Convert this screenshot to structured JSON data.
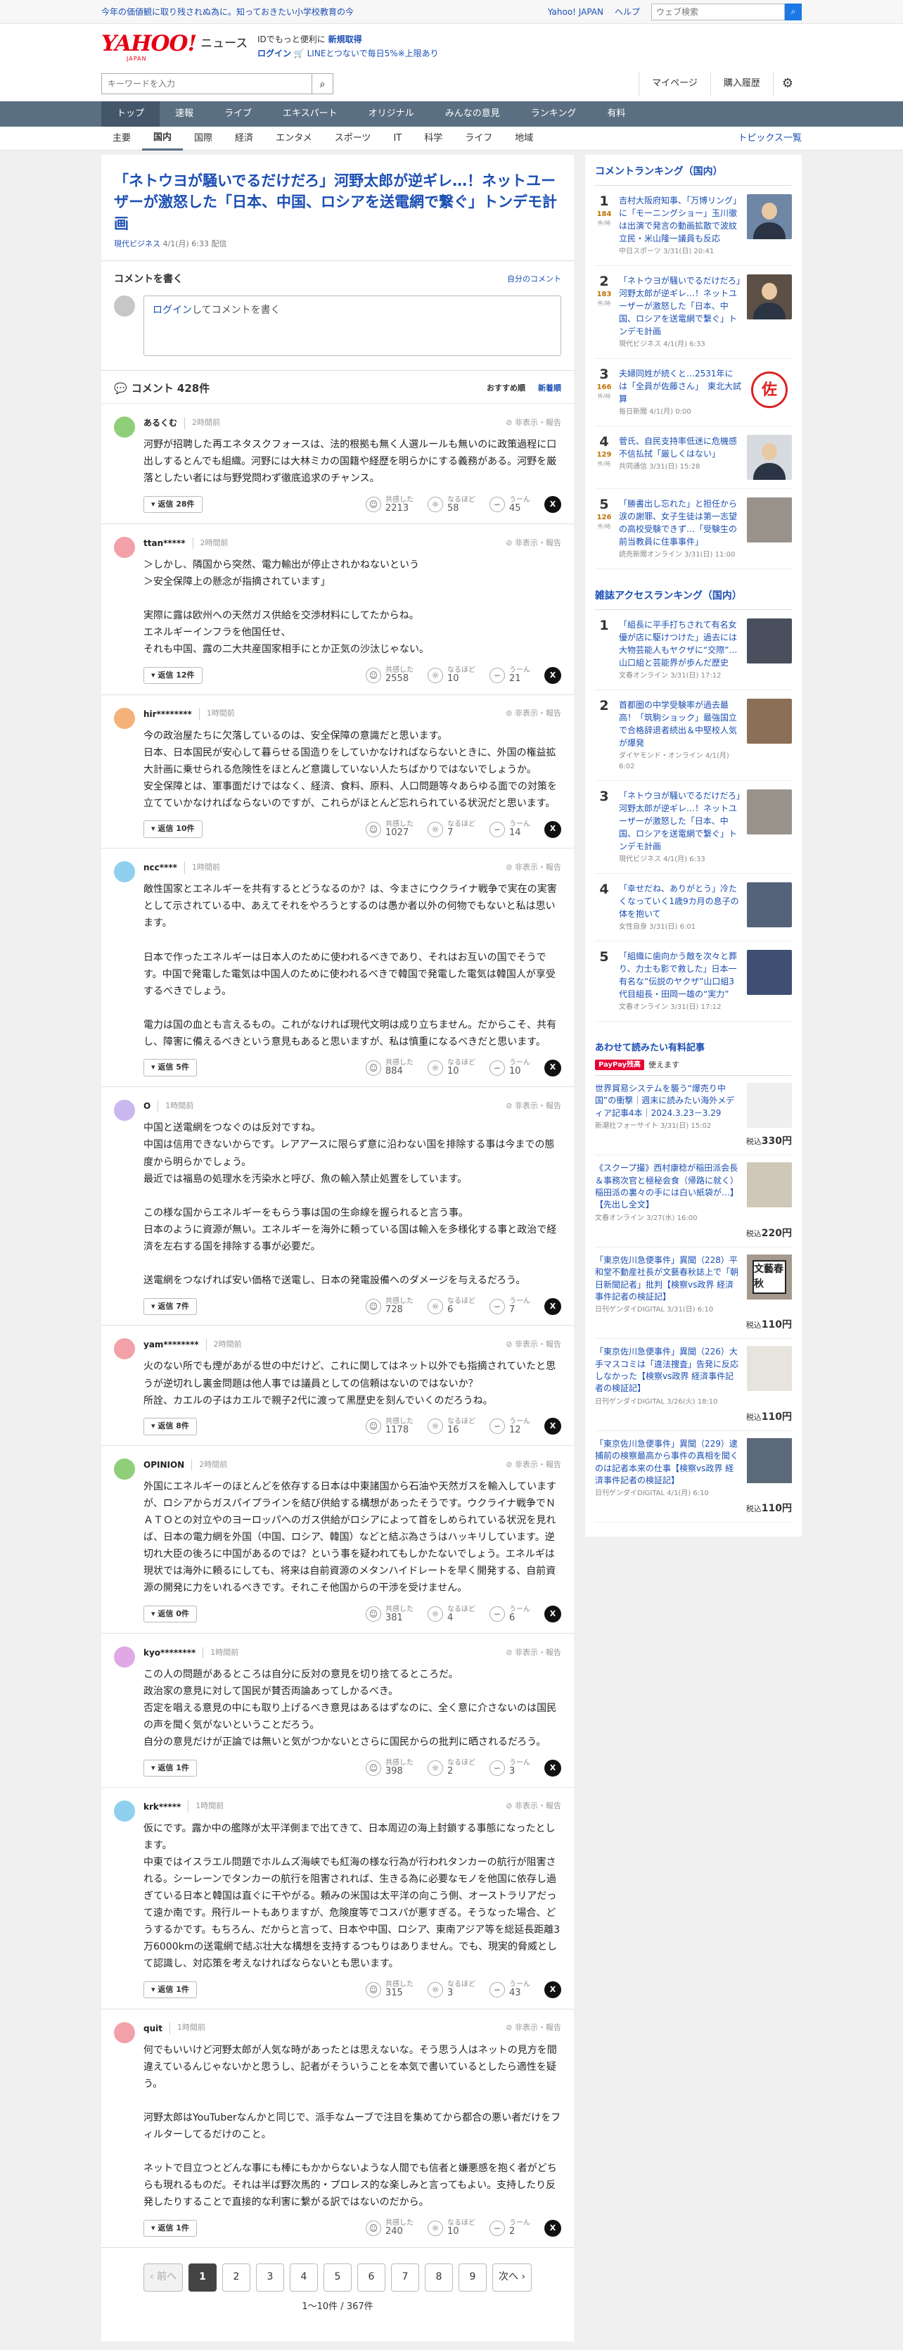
{
  "topbar": {
    "promo": "今年の価値観に取り残されぬ為に。知っておきたい小学校教育の今",
    "links": [
      "Yahoo! JAPAN",
      "ヘルプ"
    ],
    "search_placeholder": "ウェブ検索"
  },
  "header": {
    "logo": "YAHOO!",
    "logo_jp": "JAPAN",
    "service": "ニュース",
    "id_line1": "IDでもっと便利に",
    "id_line1_link": "新規取得",
    "id_line2_link": "ログイン",
    "id_line2": "LINEとつないで毎日5%※上限あり",
    "search_placeholder": "キーワードを入力",
    "actions": [
      "マイページ",
      "購入履歴"
    ]
  },
  "nav1": [
    "トップ",
    "速報",
    "ライブ",
    "エキスパート",
    "オリジナル",
    "みんなの意見",
    "ランキング",
    "有料"
  ],
  "nav2": [
    "主要",
    "国内",
    "国際",
    "経済",
    "エンタメ",
    "スポーツ",
    "IT",
    "科学",
    "ライフ",
    "地域"
  ],
  "nav2_right": "トピックス一覧",
  "article": {
    "title": "「ネトウヨが騒いでるだけだろ」河野太郎が逆ギレ…！ネットユーザーが激怒した「日本、中国、ロシアを送電網で繋ぐ」トンデモ計画",
    "source": "現代ビジネス",
    "date": "4/1(月) 6:33",
    "delivered": "配信"
  },
  "write": {
    "title": "コメントを書く",
    "link": "自分のコメント",
    "login": "ログイン",
    "placeholder_rest": "してコメントを書く"
  },
  "comments_head": {
    "title": "コメント 428件",
    "sort1": "おすすめ順",
    "sort2": "新着順"
  },
  "react_labels": {
    "agree": "共感した",
    "naruhodo": "なるほど",
    "hmm": "うーん",
    "flags": "⊘ 非表示・報告"
  },
  "comments": [
    {
      "user": "あるくむ",
      "time": "2時間前",
      "text": "河野が招聘した再エネタスクフォースは、法的根拠も無く人選ルールも無いのに政策過程に口出しするとんでも組織。河野には大林ミカの国籍や経歴を明らかにする義務がある。河野を厳落としたい者には与野党問わず徹底追求のチャンス。",
      "reply": "返信 28件",
      "agree": "2213",
      "naruhodo": "58",
      "hmm": "45",
      "color": "#8fcf7a"
    },
    {
      "user": "ttan*****",
      "time": "2時間前",
      "text": "＞しかし、隣国から突然、電力輸出が停止されかねないという\n＞安全保障上の懸念が指摘されています」\n\n実際に露は欧州への天然ガス供給を交渉材料にしてたからね。\nエネルギーインフラを他国任せ、\nそれも中国、露の二大共産国家相手にとか正気の沙汰じゃない。",
      "reply": "返信 12件",
      "agree": "2558",
      "naruhodo": "10",
      "hmm": "21",
      "color": "#f2a1a8"
    },
    {
      "user": "hir********",
      "time": "1時間前",
      "text": "今の政治屋たちに欠落しているのは、安全保障の意識だと思います。\n日本、日本国民が安心して暮らせる国造りをしていかなければならないときに、外国の権益拡大計画に乗せられる危険性をほとんど意識していない人たちばかりではないでしょうか。\n安全保障とは、軍事面だけではなく、経済、食料、原料、人口問題等々あらゆる面での対策を立てていかなければならないのですが、これらがほとんど忘れられている状況だと思います。",
      "reply": "返信 10件",
      "agree": "1027",
      "naruhodo": "7",
      "hmm": "14",
      "color": "#f4b27a"
    },
    {
      "user": "ncc****",
      "time": "1時間前",
      "text": "敵性国家とエネルギーを共有するとどうなるのか？は、今まさにウクライナ戦争で実在の実害として示されている中、あえてそれをやろうとするのは愚か者以外の何物でもないと私は思います。\n\n日本で作ったエネルギーは日本人のために使われるべきであり、それはお互いの国でそうです。中国で発電した電気は中国人のために使われるべきで韓国で発電した電気は韓国人が享受するべきでしょう。\n\n電力は国の血とも言えるもの。これがなければ現代文明は成り立ちません。だからこそ、共有し、障害に備えるべきという意見もあると思いますが、私は慎重になるべきだと思います。",
      "reply": "返信 5件",
      "agree": "884",
      "naruhodo": "10",
      "hmm": "10",
      "color": "#8fd0ee"
    },
    {
      "user": "O",
      "time": "1時間前",
      "text": "中国と送電網をつなぐのは反対ですね。\n中国は信用できないからです。レアアースに限らず意に沿わない国を排除する事は今までの態度から明らかでしょう。\n最近では福島の処理水を汚染水と呼び、魚の輸入禁止処置をしています。\n\nこの様な国からエネルギーをもらう事は国の生命線を握られると言う事。\n日本のように資源が無い。エネルギーを海外に頼っている国は輸入を多様化する事と政治で経済を左右する国を排除する事が必要だ。\n\n送電網をつなげれば安い価格で送電し、日本の発電設備へのダメージを与えるだろう。",
      "reply": "返信 7件",
      "agree": "728",
      "naruhodo": "6",
      "hmm": "7",
      "color": "#c9b8f0"
    },
    {
      "user": "yam********",
      "time": "2時間前",
      "text": "火のない所でも煙があがる世の中だけど、これに関してはネット以外でも指摘されていたと思うが逆切れし裏金問題は他人事では議員としての信頼はないのではないか？\n所詮、カエルの子はカエルで親子2代に渡って黒歴史を刻んでいくのだろうね。",
      "reply": "返信 8件",
      "agree": "1178",
      "naruhodo": "16",
      "hmm": "12",
      "color": "#f2a1a8"
    },
    {
      "user": "OPINION",
      "time": "2時間前",
      "text": "外国にエネルギーのほとんどを依存する日本は中東諸国から石油や天然ガスを輸入していますが、ロシアからガスパイプラインを結び供給する構想があったそうです。ウクライナ戦争でＮＡＴＯとの対立やのヨーロッパへのガス供給がロシアによって首をしめられている状況を見れば、日本の電力網を外国（中国、ロシア、韓国）などと結ぶ為さうはハッキリしています。逆切れ大臣の後ろに中国があるのでは？という事を疑われてもしかたないでしょう。エネルギは現状では海外に頼るにしても、将来は自前資源のメタンハイドレートを早く開発する、自前資源の開発に力をいれるべきです。それこそ他国からの干渉を受けません。",
      "reply": "返信 0件",
      "agree": "381",
      "naruhodo": "4",
      "hmm": "6",
      "color": "#8fcf7a"
    },
    {
      "user": "kyo********",
      "time": "1時間前",
      "text": "この人の問題があるところは自分に反対の意見を切り捨てるところだ。\n政治家の意見に対して国民が賛否両論あってしかるべき。\n否定を唱える意見の中にも取り上げるべき意見はあるはずなのに、全く意に介さないのは国民の声を聞く気がないということだろう。\n自分の意見だけが正論では無いと気がつかないとさらに国民からの批判に晒されるだろう。",
      "reply": "返信 1件",
      "agree": "398",
      "naruhodo": "2",
      "hmm": "3",
      "color": "#e0a9e6"
    },
    {
      "user": "krk*****",
      "time": "1時間前",
      "text": "仮にです。露か中の艦隊が太平洋側まで出てきて、日本周辺の海上封鎖する事態になったとします。\n中東ではイスラエル問題でホルムズ海峡でも紅海の様な行為が行われタンカーの航行が阻害される。シーレーンでタンカーの航行を阻害されれば、生きる為に必要なモノを他国に依存し過ぎている日本と韓国は直ぐに干やがる。頼みの米国は太平洋の向こう側、オーストラリアだって遠か南です。飛行ルートもありますが、危険度等でコスパが悪すぎる。そうなった場合、どうするかです。もちろん、だからと言って、日本や中国、ロシア、東南アジア等を総延長距離3万6000kmの送電網で結ぶ壮大な構想を支持するつもりはありません。でも、現実的脅威として認識し、対応策を考えなければならないとも思います。",
      "reply": "返信 1件",
      "agree": "315",
      "naruhodo": "3",
      "hmm": "43",
      "color": "#8fd0ee"
    },
    {
      "user": "quit",
      "time": "1時間前",
      "text": "何でもいいけど河野太郎が人気な時があったとは思えないな。そう思う人はネットの見方を間違えているんじゃないかと思うし、記者がそういうことを本気で書いているとしたら適性を疑う。\n\n河野太郎はYouTuberなんかと同じで、派手なムーブで注目を集めてから都合の悪い者だけをフィルターしてるだけのこと。\n\nネットで目立つとどんな事にも棒にもかからないような人間でも信者と嫌悪感を抱く者がどちらも現れるものだ。それは半ば野次馬的・プロレス的な楽しみと言ってもよい。支持したり反発したりすることで直接的な利害に繋がる訳ではないのだから。",
      "reply": "返信 1件",
      "agree": "240",
      "naruhodo": "10",
      "hmm": "2",
      "color": "#f2a1a8"
    }
  ],
  "pager": {
    "prev": "‹ 前へ",
    "next": "次へ ›",
    "pages": [
      "1",
      "2",
      "3",
      "4",
      "5",
      "6",
      "7",
      "8",
      "9"
    ],
    "count": "1〜10件 / 367件"
  },
  "side": {
    "ranking_title": "コメントランキング（国内）",
    "ranking": [
      {
        "n": "1",
        "c": "184",
        "title": "吉村大阪府知事、「万博リング」に「モーニングショー」玉川徹は出演で発言の動画拡散で波紋　立民・米山隆一議員も反応",
        "meta": "中日スポーツ 3/31(日) 20:41",
        "th": "person"
      },
      {
        "n": "2",
        "c": "183",
        "title": "「ネトウヨが騒いでるだけだろ」河野太郎が逆ギレ…！ネットユーザーが激怒した「日本、中国、ロシアを送電網で繋ぐ」トンデモ計画",
        "meta": "現代ビジネス 4/1(月) 6:33",
        "th": "person"
      },
      {
        "n": "3",
        "c": "166",
        "title": "夫婦同姓が続くと…2531年には「全員が佐藤さん」　東北大試算",
        "meta": "毎日新聞 4/1(月) 0:00",
        "th": "seal"
      },
      {
        "n": "4",
        "c": "129",
        "title": "菅氏、自民支持率低迷に危機感不信払拭「厳しくはない」",
        "meta": "共同通信 3/31(日) 15:28",
        "th": "person"
      },
      {
        "n": "5",
        "c": "126",
        "title": "「勝書出し忘れた」と担任から涙の謝罪、女子生徒は第一志望の高校受験できず…「受験生の前当教員に住事事件」",
        "meta": "読売新聞オンライン 3/31(日) 11:00",
        "th": "plain"
      }
    ],
    "comment_count_label": "件/時",
    "seal_char": "佐",
    "access_title": "雑誌アクセスランキング（国内）",
    "access": [
      {
        "n": "1",
        "title": "「組長に平手打ちされて有名女優が店に駆けつけた」過去には大物芸能人もヤクザに“交際”…山口組と芸能界が歩んだ歴史",
        "meta": "文春オンライン 3/31(日) 17:12"
      },
      {
        "n": "2",
        "title": "首都圏の中学受験率が過去最高！「筑駒ショック」最強国立で合格辞退者続出＆中堅校人気が爆発",
        "meta": "ダイヤモンド・オンライン 4/1(月) 6:02"
      },
      {
        "n": "3",
        "title": "「ネトウヨが騒いでるだけだろ」河野太郎が逆ギレ…！ネットユーザーが激怒した「日本、中国、ロシアを送電網で繋ぐ」トンデモ計画",
        "meta": "現代ビジネス 4/1(月) 6:33"
      },
      {
        "n": "4",
        "title": "「幸せだね、ありがとう」冷たくなっていく1歳9カ月の息子の体を抱いて",
        "meta": "女性自身 3/31(日) 6:01"
      },
      {
        "n": "5",
        "title": "「組織に歯向かう敵を次々と葬り、力士も影で救した」日本一有名な“伝説のヤクザ”山口組3代目組長・田岡一雄の“実力”",
        "meta": "文春オンライン 3/31(日) 17:12"
      }
    ],
    "paid_title": "あわせて読みたい有料記事",
    "paid_sub_badge": "PayPay残高",
    "paid_sub": "使えます",
    "paid_price_prefix": "税込",
    "paid": [
      {
        "title": "世界貿易システムを襲う“爆売り中国”の衝撃｜週末に読みたい海外メディア記事4本｜2024.3.23－3.29",
        "meta": "新潮社フォーサイト 3/31(日) 15:02",
        "price": "330円"
      },
      {
        "title": "《スクープ撮》西村康稔が稲田派会長＆事務次官と極秘会食（帰路に就く）稲田派の裏々の手には白い紙袋が…】【先出し全文】",
        "meta": "文春オンライン 3/27(水) 16:00",
        "price": "220円"
      },
      {
        "title": "「東京佐川急便事件」異聞（228）平和堂不動産社長が文藝春秋誌上で「朝日新聞記者」批判【検察vs政界 経済事件記者の検証記】",
        "meta": "日刊ゲンダイDIGITAL 3/31(日) 6:10",
        "price": "110円"
      },
      {
        "title": "「東京佐川急便事件」異聞（226）大手マスコミは「違法捜査」告発に反応しなかった【検察vs政界 経済事件記者の検証記】",
        "meta": "日刊ゲンダイDIGITAL 3/26(火) 18:10",
        "price": "110円"
      },
      {
        "title": "「東京佐川急便事件」異聞（229）逮捕前の検察最高から事件の真相を聞くのは記者本来の仕事【検察vs政界 経済事件記者の検証記】",
        "meta": "日刊ゲンダイDIGITAL 4/1(月) 6:10",
        "price": "110円"
      }
    ],
    "bunshun_text": "文藝春秋"
  }
}
